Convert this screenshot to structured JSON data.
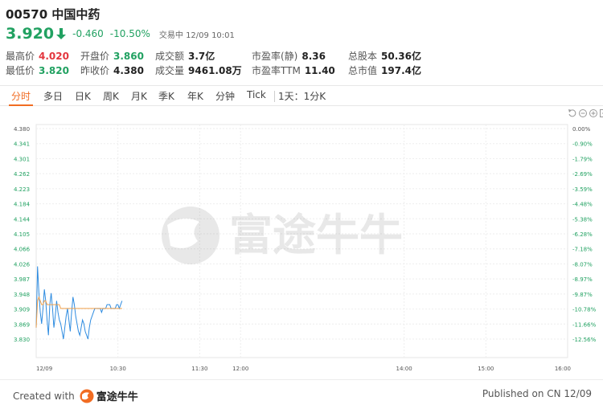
{
  "stock": {
    "code_name": "00570 中国中药",
    "price": "3.920",
    "change": "-0.460",
    "change_pct": "-10.50%",
    "trade_status": "交易中 12/09 10:01",
    "price_color": "#21a161"
  },
  "stats": {
    "high_label": "最高价",
    "high_value": "4.020",
    "low_label": "最低价",
    "low_value": "3.820",
    "open_label": "开盘价",
    "open_value": "3.860",
    "prev_close_label": "昨收价",
    "prev_close_value": "4.380",
    "turnover_label": "成交额",
    "turnover_value": "3.7亿",
    "volume_label": "成交量",
    "volume_value": "9461.08万",
    "pe_static_label": "市盈率(静)",
    "pe_static_value": "8.36",
    "pe_ttm_label": "市盈率TTM",
    "pe_ttm_value": "11.40",
    "total_shares_label": "总股本",
    "total_shares_value": "50.36亿",
    "market_cap_label": "总市值",
    "market_cap_value": "197.4亿"
  },
  "tabs": [
    "分时",
    "多日",
    "日K",
    "周K",
    "月K",
    "季K",
    "年K",
    "分钟",
    "Tick",
    "1天：1分K"
  ],
  "active_tab": "分时",
  "toolbar_icons": [
    "reset-icon",
    "zoom-out-icon",
    "zoom-in-icon",
    "fullscreen-icon"
  ],
  "watermark": "富途牛牛",
  "footer": {
    "created_label": "Created with",
    "brand": "富途牛牛",
    "published": "Published on CN 12/09"
  },
  "colors": {
    "accent": "#f16c22",
    "down": "#21a161",
    "up": "#e3363e",
    "price_line": "#2f8ce0",
    "avg_line": "#f0a04b",
    "pct_axis": "#21a161"
  },
  "chart_data": {
    "type": "line",
    "y_ticks": [
      "4.380",
      "4.341",
      "4.301",
      "4.262",
      "4.223",
      "4.184",
      "4.144",
      "4.105",
      "4.066",
      "4.026",
      "3.987",
      "3.948",
      "3.909",
      "3.869",
      "3.830"
    ],
    "pct_ticks": [
      "0.00%",
      "-0.90%",
      "-1.79%",
      "-2.69%",
      "-3.59%",
      "-4.48%",
      "-5.38%",
      "-6.28%",
      "-7.18%",
      "-8.07%",
      "-8.97%",
      "-9.87%",
      "-10.78%",
      "-11.66%",
      "-12.56%"
    ],
    "x_ticks": [
      "12/09",
      "10:30",
      "11:30",
      "12:00",
      "14:00",
      "15:00",
      "16:00"
    ],
    "ylim": [
      3.8,
      4.38
    ],
    "minutes_total": 390,
    "x_tick_minutes": [
      0,
      60,
      120,
      150,
      270,
      330,
      390
    ],
    "series": [
      {
        "values": [
          3.86,
          4.02,
          3.95,
          3.9,
          3.87,
          3.91,
          3.96,
          3.93,
          3.88,
          3.84,
          3.92,
          3.95,
          3.91,
          3.86,
          3.89,
          3.93,
          3.9,
          3.88,
          3.87,
          3.85,
          3.83,
          3.86,
          3.89,
          3.91,
          3.88,
          3.85,
          3.9,
          3.94,
          3.92,
          3.89,
          3.87,
          3.85,
          3.84,
          3.86,
          3.88,
          3.87,
          3.85,
          3.84,
          3.83,
          3.86,
          3.88,
          3.89,
          3.9,
          3.91,
          3.91,
          3.91,
          3.91,
          3.91,
          3.9,
          3.91,
          3.91,
          3.91,
          3.92,
          3.92,
          3.92,
          3.91,
          3.91,
          3.91,
          3.91,
          3.92,
          3.92,
          3.91,
          3.92,
          3.93
        ]
      },
      {
        "values": [
          3.86,
          3.93,
          3.94,
          3.93,
          3.92,
          3.92,
          3.93,
          3.93,
          3.92,
          3.92,
          3.92,
          3.92,
          3.92,
          3.92,
          3.92,
          3.92,
          3.92,
          3.92,
          3.91,
          3.91,
          3.91,
          3.91,
          3.91,
          3.91,
          3.91,
          3.91,
          3.91,
          3.91,
          3.91,
          3.91,
          3.91,
          3.91,
          3.91,
          3.91,
          3.91,
          3.91,
          3.91,
          3.91,
          3.91,
          3.91,
          3.91,
          3.91,
          3.91,
          3.91,
          3.91,
          3.91,
          3.91,
          3.91,
          3.91,
          3.91,
          3.91,
          3.91,
          3.91,
          3.91,
          3.91,
          3.91,
          3.91,
          3.91,
          3.91,
          3.91,
          3.91,
          3.91,
          3.91,
          3.91
        ]
      }
    ]
  }
}
